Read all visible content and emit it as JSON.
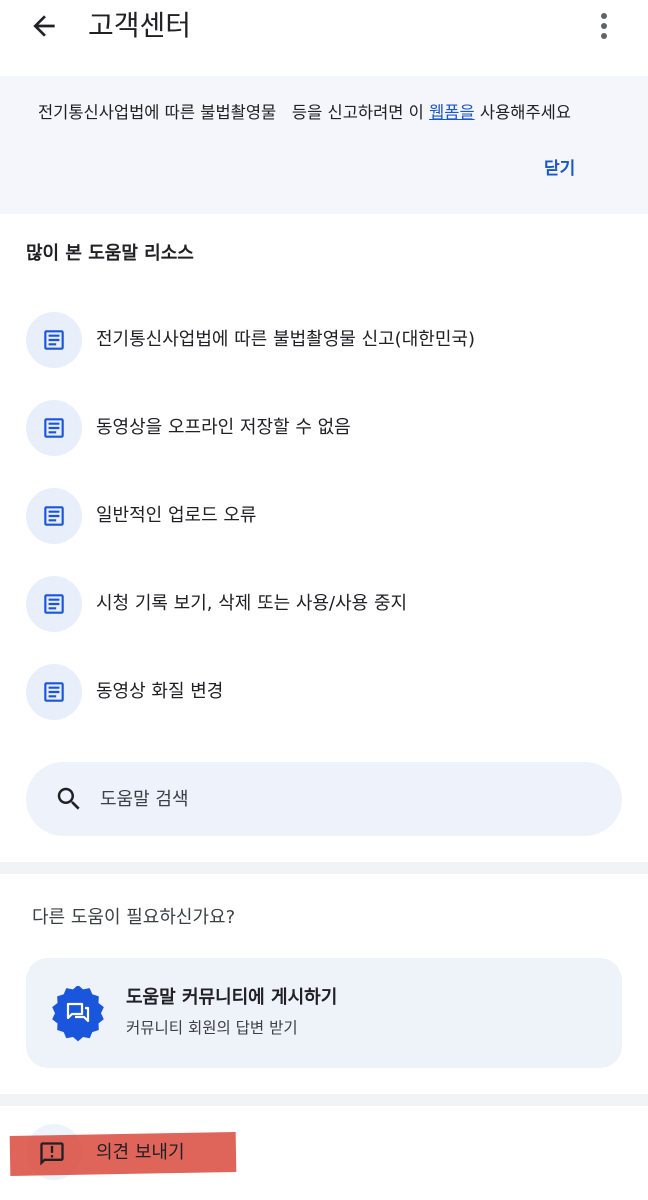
{
  "header": {
    "title": "고객센터"
  },
  "banner": {
    "text_before": "전기통신사업법에 따른 불법촬영물   등을 신고하려면 이 ",
    "link_text": "웹폼을",
    "text_after": " 사용해주세요",
    "close_label": "닫기"
  },
  "resources": {
    "title": "많이 본 도움말 리소스",
    "items": [
      {
        "label": "전기통신사업법에 따른 불법촬영물 신고(대한민국)",
        "icon": "article-icon"
      },
      {
        "label": "동영상을 오프라인 저장할 수 없음",
        "icon": "article-icon"
      },
      {
        "label": "일반적인 업로드 오류",
        "icon": "article-icon"
      },
      {
        "label": "시청 기록 보기, 삭제 또는 사용/사용 중지",
        "icon": "article-icon"
      },
      {
        "label": "동영상 화질 변경",
        "icon": "article-icon"
      }
    ]
  },
  "search": {
    "placeholder": "도움말 검색"
  },
  "more_help": {
    "title": "다른 도움이 필요하신가요?",
    "community": {
      "title": "도움말 커뮤니티에 게시하기",
      "subtitle": "커뮤니티 회원의 답변 받기",
      "icon": "forum-icon"
    }
  },
  "feedback": {
    "label": "의견 보내기",
    "icon": "feedback-icon"
  },
  "colors": {
    "accent": "#1a57c8",
    "badge": "#1a56db",
    "banner_bg": "#f4f6fb",
    "highlight": "#db4e42"
  }
}
